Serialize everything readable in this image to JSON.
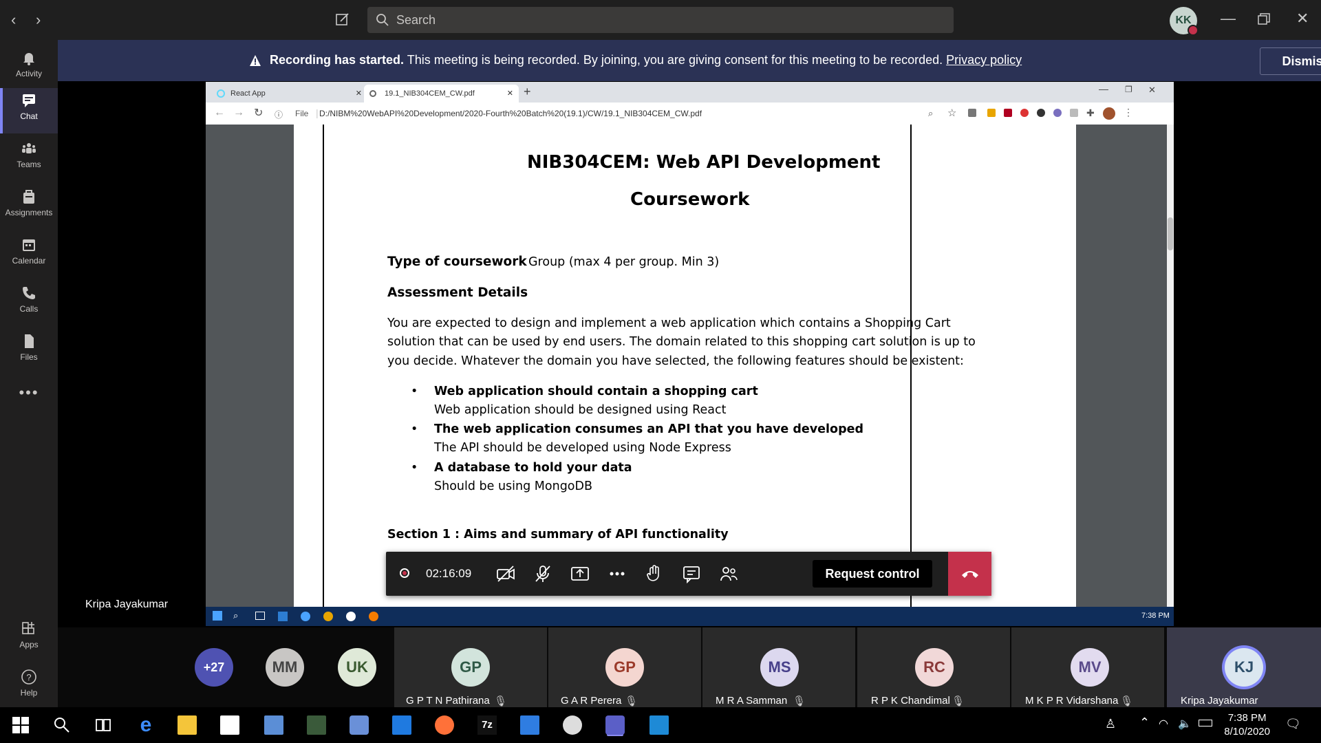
{
  "topbar": {
    "search_placeholder": "Search",
    "avatar_initials": "KK"
  },
  "banner": {
    "title": "Recording has started.",
    "message": " This meeting is being recorded. By joining, you are giving consent for this meeting to be recorded. ",
    "link": "Privacy policy",
    "dismiss": "Dismiss"
  },
  "rail": {
    "items": [
      {
        "label": "Activity"
      },
      {
        "label": "Chat"
      },
      {
        "label": "Teams"
      },
      {
        "label": "Assignments"
      },
      {
        "label": "Calendar"
      },
      {
        "label": "Calls"
      },
      {
        "label": "Files"
      }
    ],
    "apps": "Apps",
    "help": "Help"
  },
  "browser": {
    "tabs": [
      {
        "label": "React App"
      },
      {
        "label": "19.1_NIB304CEM_CW.pdf"
      }
    ],
    "file_label": "File",
    "url": "D:/NIBM%20WebAPI%20Development/2020-Fourth%20Batch%20(19.1)/CW/19.1_NIB304CEM_CW.pdf"
  },
  "document": {
    "title": "NIB304CEM: Web API Development",
    "subtitle": "Coursework",
    "type_label": "Type of coursework",
    "type_value": "Group (max 4 per group. Min 3)",
    "assessment_heading": "Assessment Details",
    "para_lines": [
      "You are expected to design and implement a web application which contains a Shopping Cart",
      "solution that can be used by end users. The domain related to this shopping cart solution is up to",
      "you decide. Whatever the domain you have selected, the following features should be existent:"
    ],
    "bullets": [
      {
        "title": "Web application should contain a shopping cart",
        "sub": "Web application should be designed using React"
      },
      {
        "title": "The web application consumes an API that you have developed",
        "sub": "The API should be developed using Node Express"
      },
      {
        "title": "A database to hold your data",
        "sub": "Should be using MongoDB"
      }
    ],
    "section1": "Section 1 : Aims and summary of API functionality"
  },
  "vm_taskbar": {
    "time": "7:38 PM"
  },
  "call": {
    "timer": "02:16:09",
    "request_control": "Request control",
    "presenter": "Kripa Jayakumar"
  },
  "participants": [
    {
      "initials": "+27",
      "name": ""
    },
    {
      "initials": "MM",
      "name": ""
    },
    {
      "initials": "UK",
      "name": ""
    },
    {
      "initials": "GP",
      "name": "G P T N Pathirana"
    },
    {
      "initials": "GP",
      "name": "G A R Perera"
    },
    {
      "initials": "MS",
      "name": "M R A Samman"
    },
    {
      "initials": "RC",
      "name": "R P K Chandimal"
    },
    {
      "initials": "MV",
      "name": "M K P R Vidarshana"
    },
    {
      "initials": "KJ",
      "name": "Kripa Jayakumar"
    }
  ],
  "taskbar": {
    "time": "7:38 PM",
    "date": "8/10/2020"
  },
  "colors": {
    "banner": "#2b3255",
    "accent": "#7f85f5",
    "hangup": "#c4314b"
  }
}
